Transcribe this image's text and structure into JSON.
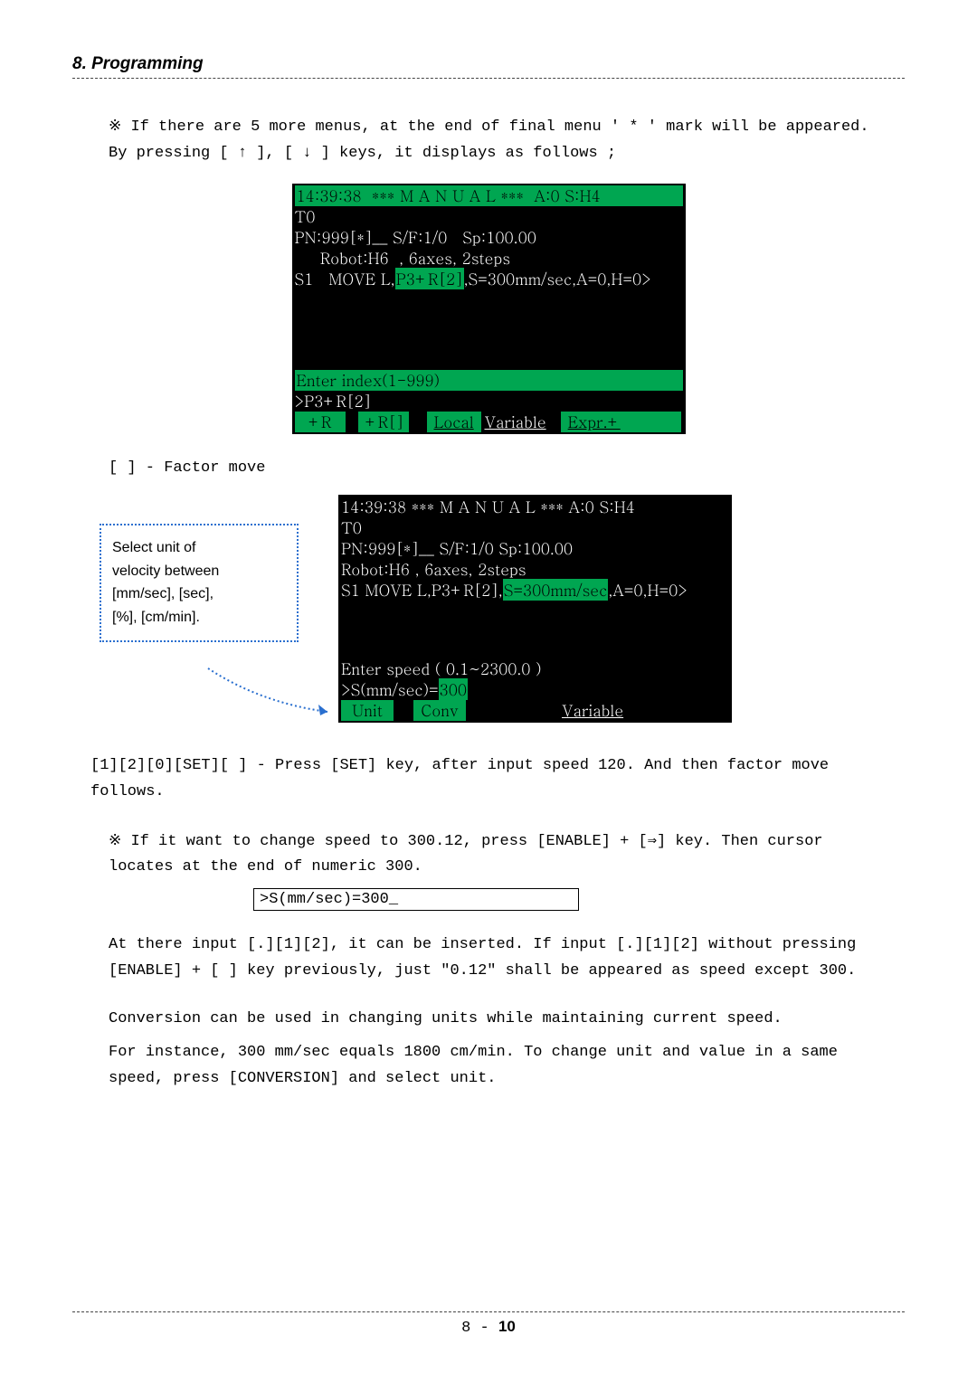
{
  "header": {
    "title": "8. Programming"
  },
  "intro": {
    "line1": "※ If there are 5 more menus, at the end of final menu ' * ' mark will be appeared.",
    "line2": "By pressing [ ↑  ], [ ↓  ] keys, it displays as follows ;"
  },
  "term1": {
    "top": "14:39:38  *** M A N U A L ***  A:0 S:H4",
    "l1": "T0",
    "l2": "PN:999[*]__ S/F:1/0   Sp:100.00",
    "l3": "     Robot:H6  , 6axes, 2steps",
    "l4a": "S1   MOVE L,",
    "l4_hl": "P3+R[2]",
    "l4b": ",S=300mm/sec,A=0,H=0>",
    "prompt": "Enter index(1-999)",
    "entry": ">P3+R[2]",
    "s1": "+R",
    "s2": "+R[]",
    "s3": "Local",
    "s4": "Variable",
    "s5": "Expr.+"
  },
  "subheading": "[   ] - Factor move",
  "callout": {
    "l1": "Select unit of",
    "l2": "velocity between",
    "l3": "[mm/sec], [sec],",
    "l4": "[%], [cm/min]."
  },
  "term2": {
    "top": "14:39:38  *** M A N U A L ***  A:0 S:H4",
    "l1": "T0",
    "l2": "PN:999[*]__ S/F:1/0   Sp:100.00",
    "l3": "     Robot:H6  , 6axes, 2steps",
    "l4a": "S1   MOVE L,P3+R[2],",
    "l4_hl": "S=300mm/sec",
    "l4b": ",A=0,H=0>",
    "prompt": "Enter speed ( 0.1~2300.0 )",
    "entry_a": ">S(mm/sec)=",
    "entry_hl": "300",
    "s1": "Unit",
    "s2": "Conv",
    "s3": "Variable"
  },
  "below1": "[1][2][0][SET][  ] - Press [SET] key, after input speed 120. And then factor move follows.",
  "below2": " ※ If it want to change speed to 300.12, press [ENABLE] + [⇒] key. Then cursor locates at the end of numeric 300.",
  "inputbox": ">S(mm/sec)=300_",
  "below3": "At there input [.][1][2], it can be inserted.    If input [.][1][2] without pressing [ENABLE] + [  ] key previously, just \"0.12\" shall be appeared as speed except 300.",
  "below4": "Conversion can be used in changing units while maintaining current speed.",
  "below5": "For instance, 300 mm/sec equals 1800 cm/min.  To change unit and value in a same speed, press [CONVERSION] and select unit.",
  "footer": {
    "page": "8 - ",
    "pagebold": "10"
  }
}
